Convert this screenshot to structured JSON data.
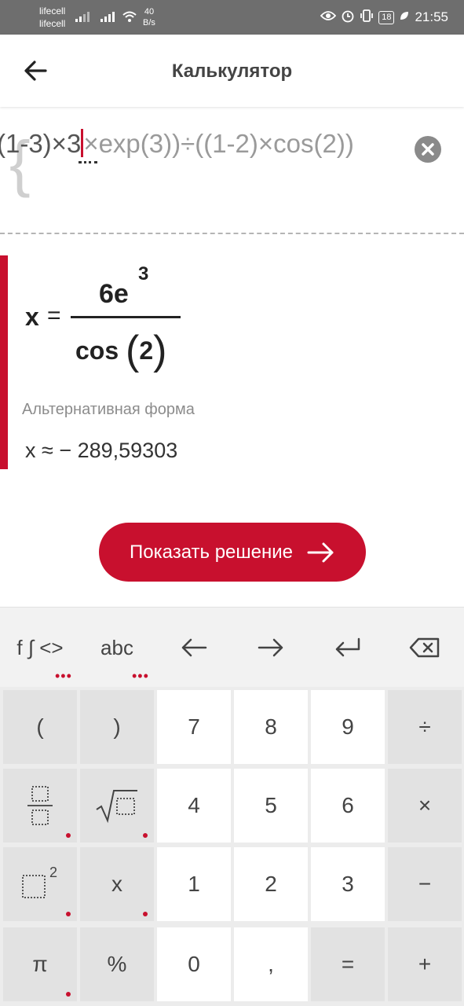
{
  "status_bar": {
    "carrier1": "lifecell",
    "carrier2": "lifecell",
    "net_speed": "40",
    "net_unit": "B/s",
    "battery": "18",
    "time": "21:55"
  },
  "header": {
    "title": "Калькулятор"
  },
  "input": {
    "expr_a": "(1-3)×3",
    "expr_b": "×exp(3))÷((1-2)×cos(2))"
  },
  "result": {
    "var": "x",
    "eq": "=",
    "numerator": "6e",
    "exponent": "3",
    "denominator_fn": "cos",
    "denominator_arg": "2",
    "alt_label": "Альтернативная форма",
    "alt_value": "x ≈ − 289,59303"
  },
  "solve_button": {
    "label": "Показать решение"
  },
  "keyboard": {
    "tabs": {
      "functions": "f ∫ <>",
      "letters": "abc",
      "left": "←",
      "right": "→",
      "enter": "↵",
      "backspace": "⌫"
    },
    "keys": {
      "open_paren": "(",
      "close_paren": ")",
      "seven": "7",
      "eight": "8",
      "nine": "9",
      "divide": "÷",
      "four": "4",
      "five": "5",
      "six": "6",
      "multiply": "×",
      "square_exp": "2",
      "x": "x",
      "one": "1",
      "two": "2",
      "three": "3",
      "minus": "−",
      "pi": "π",
      "percent": "%",
      "zero": "0",
      "comma": ",",
      "equals": "=",
      "plus": "+"
    }
  },
  "colors": {
    "accent": "#c8102e",
    "statusbar": "#6e6e6e"
  }
}
